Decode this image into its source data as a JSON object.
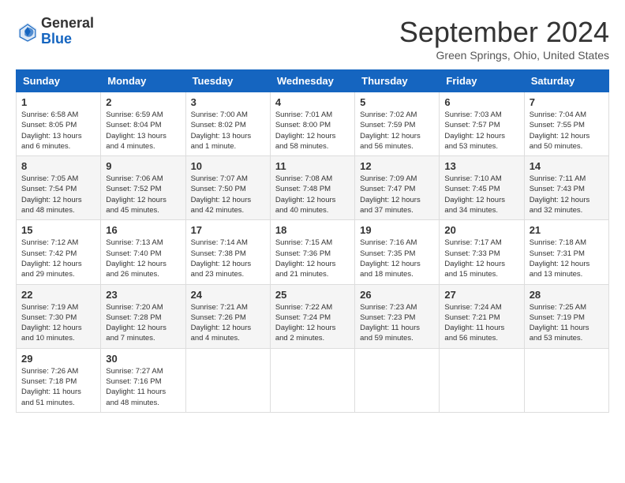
{
  "header": {
    "logo_general": "General",
    "logo_blue": "Blue",
    "month_title": "September 2024",
    "location": "Green Springs, Ohio, United States"
  },
  "weekdays": [
    "Sunday",
    "Monday",
    "Tuesday",
    "Wednesday",
    "Thursday",
    "Friday",
    "Saturday"
  ],
  "weeks": [
    [
      {
        "day": 1,
        "sunrise": "6:58 AM",
        "sunset": "8:05 PM",
        "daylight": "13 hours and 6 minutes"
      },
      {
        "day": 2,
        "sunrise": "6:59 AM",
        "sunset": "8:04 PM",
        "daylight": "13 hours and 4 minutes"
      },
      {
        "day": 3,
        "sunrise": "7:00 AM",
        "sunset": "8:02 PM",
        "daylight": "13 hours and 1 minute"
      },
      {
        "day": 4,
        "sunrise": "7:01 AM",
        "sunset": "8:00 PM",
        "daylight": "12 hours and 58 minutes"
      },
      {
        "day": 5,
        "sunrise": "7:02 AM",
        "sunset": "7:59 PM",
        "daylight": "12 hours and 56 minutes"
      },
      {
        "day": 6,
        "sunrise": "7:03 AM",
        "sunset": "7:57 PM",
        "daylight": "12 hours and 53 minutes"
      },
      {
        "day": 7,
        "sunrise": "7:04 AM",
        "sunset": "7:55 PM",
        "daylight": "12 hours and 50 minutes"
      }
    ],
    [
      {
        "day": 8,
        "sunrise": "7:05 AM",
        "sunset": "7:54 PM",
        "daylight": "12 hours and 48 minutes"
      },
      {
        "day": 9,
        "sunrise": "7:06 AM",
        "sunset": "7:52 PM",
        "daylight": "12 hours and 45 minutes"
      },
      {
        "day": 10,
        "sunrise": "7:07 AM",
        "sunset": "7:50 PM",
        "daylight": "12 hours and 42 minutes"
      },
      {
        "day": 11,
        "sunrise": "7:08 AM",
        "sunset": "7:48 PM",
        "daylight": "12 hours and 40 minutes"
      },
      {
        "day": 12,
        "sunrise": "7:09 AM",
        "sunset": "7:47 PM",
        "daylight": "12 hours and 37 minutes"
      },
      {
        "day": 13,
        "sunrise": "7:10 AM",
        "sunset": "7:45 PM",
        "daylight": "12 hours and 34 minutes"
      },
      {
        "day": 14,
        "sunrise": "7:11 AM",
        "sunset": "7:43 PM",
        "daylight": "12 hours and 32 minutes"
      }
    ],
    [
      {
        "day": 15,
        "sunrise": "7:12 AM",
        "sunset": "7:42 PM",
        "daylight": "12 hours and 29 minutes"
      },
      {
        "day": 16,
        "sunrise": "7:13 AM",
        "sunset": "7:40 PM",
        "daylight": "12 hours and 26 minutes"
      },
      {
        "day": 17,
        "sunrise": "7:14 AM",
        "sunset": "7:38 PM",
        "daylight": "12 hours and 23 minutes"
      },
      {
        "day": 18,
        "sunrise": "7:15 AM",
        "sunset": "7:36 PM",
        "daylight": "12 hours and 21 minutes"
      },
      {
        "day": 19,
        "sunrise": "7:16 AM",
        "sunset": "7:35 PM",
        "daylight": "12 hours and 18 minutes"
      },
      {
        "day": 20,
        "sunrise": "7:17 AM",
        "sunset": "7:33 PM",
        "daylight": "12 hours and 15 minutes"
      },
      {
        "day": 21,
        "sunrise": "7:18 AM",
        "sunset": "7:31 PM",
        "daylight": "12 hours and 13 minutes"
      }
    ],
    [
      {
        "day": 22,
        "sunrise": "7:19 AM",
        "sunset": "7:30 PM",
        "daylight": "12 hours and 10 minutes"
      },
      {
        "day": 23,
        "sunrise": "7:20 AM",
        "sunset": "7:28 PM",
        "daylight": "12 hours and 7 minutes"
      },
      {
        "day": 24,
        "sunrise": "7:21 AM",
        "sunset": "7:26 PM",
        "daylight": "12 hours and 4 minutes"
      },
      {
        "day": 25,
        "sunrise": "7:22 AM",
        "sunset": "7:24 PM",
        "daylight": "12 hours and 2 minutes"
      },
      {
        "day": 26,
        "sunrise": "7:23 AM",
        "sunset": "7:23 PM",
        "daylight": "11 hours and 59 minutes"
      },
      {
        "day": 27,
        "sunrise": "7:24 AM",
        "sunset": "7:21 PM",
        "daylight": "11 hours and 56 minutes"
      },
      {
        "day": 28,
        "sunrise": "7:25 AM",
        "sunset": "7:19 PM",
        "daylight": "11 hours and 53 minutes"
      }
    ],
    [
      {
        "day": 29,
        "sunrise": "7:26 AM",
        "sunset": "7:18 PM",
        "daylight": "11 hours and 51 minutes"
      },
      {
        "day": 30,
        "sunrise": "7:27 AM",
        "sunset": "7:16 PM",
        "daylight": "11 hours and 48 minutes"
      },
      null,
      null,
      null,
      null,
      null
    ]
  ]
}
